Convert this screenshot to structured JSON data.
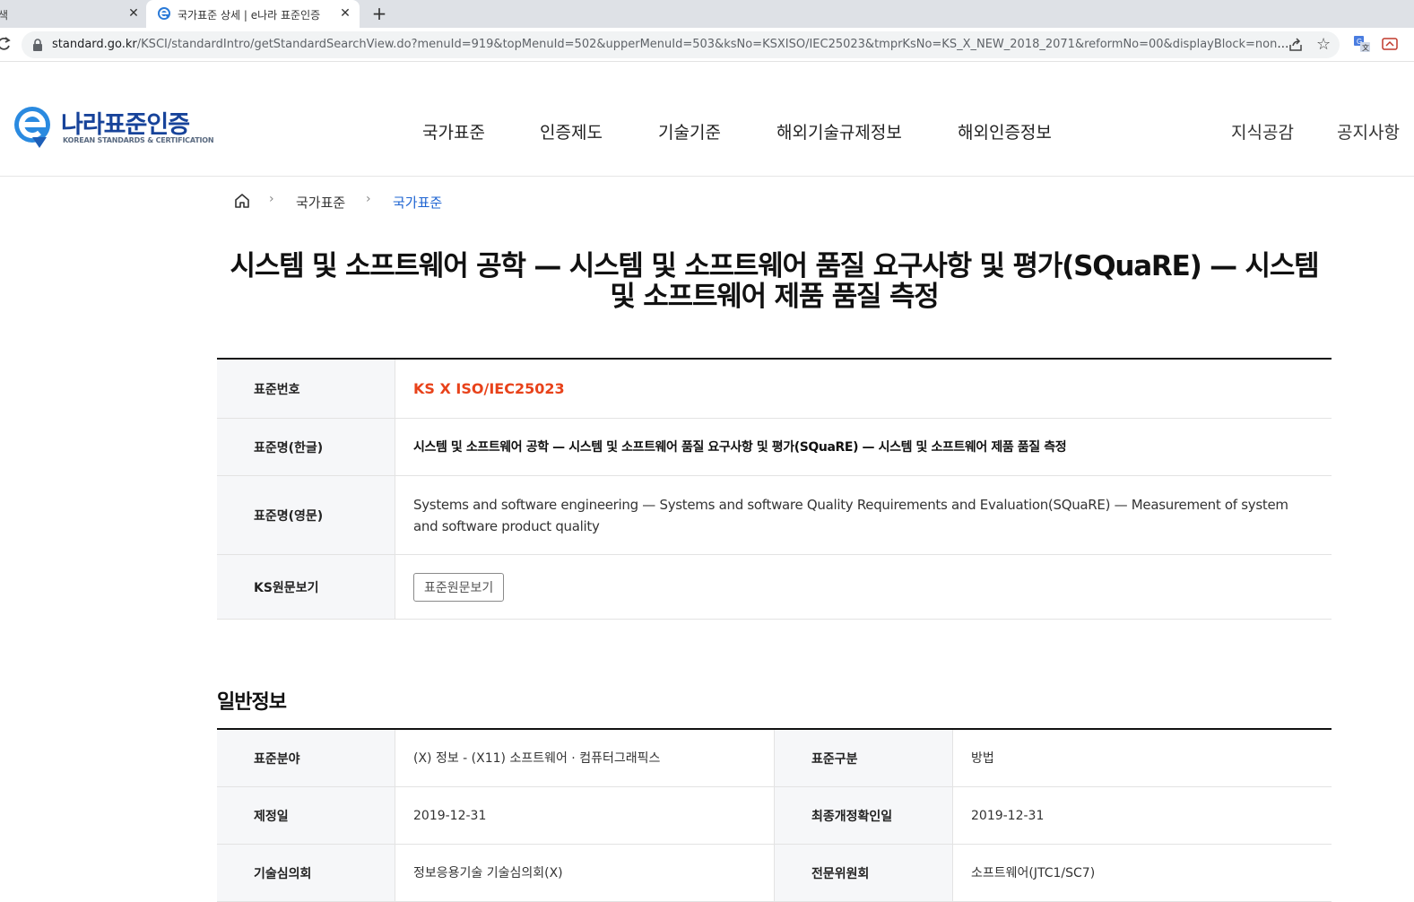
{
  "browser": {
    "prev_tab_title": "색",
    "active_tab_title": "국가표준 상세 | e나라 표준인증",
    "url_host": "standard.go.kr",
    "url_path": "/KSCI/standardIntro/getStandardSearchView.do?menuId=919&topMenuId=502&upperMenuId=503&ksNo=KSXISO/IEC25023&tmprKsNo=KS_X_NEW_2018_2071&reformNo=00&displayBlock=none&di..."
  },
  "site": {
    "logo_title": "나라표준인증",
    "logo_sub": "KOREAN STANDARDS & CERTIFICATION",
    "nav": [
      "국가표준",
      "인증제도",
      "기술기준",
      "해외기술규제정보",
      "해외인증정보"
    ],
    "util": [
      "지식공감",
      "공지사항"
    ]
  },
  "breadcrumb": {
    "items": [
      "국가표준",
      "국가표준"
    ]
  },
  "page_title": "시스템 및 소프트웨어 공학 — 시스템 및 소프트웨어 품질 요구사항 및 평가(SQuaRE) — 시스템 및 소프트웨어 제품 품질 측정",
  "standard": {
    "no_label": "표준번호",
    "no_value": "KS X ISO/IEC25023",
    "name_ko_label": "표준명(한글)",
    "name_ko_value": "시스템 및 소프트웨어 공학 — 시스템 및 소프트웨어 품질 요구사항 및 평가(SQuaRE) — 시스템 및 소프트웨어 제품 품질 측정",
    "name_en_label": "표준명(영문)",
    "name_en_value": "Systems and software engineering — Systems and software Quality Requirements and Evaluation(SQuaRE) — Measurement of system and software product quality",
    "view_label": "KS원문보기",
    "view_button": "표준원문보기"
  },
  "general": {
    "title": "일반정보",
    "rows": [
      {
        "l1": "표준분야",
        "v1": "(X) 정보 - (X11) 소프트웨어 · 컴퓨터그래픽스",
        "l2": "표준구분",
        "v2": "방법"
      },
      {
        "l1": "제정일",
        "v1": "2019-12-31",
        "l2": "최종개정확인일",
        "v2": "2019-12-31"
      },
      {
        "l1": "기술심의회",
        "v1": "정보응용기술 기술심의회(X)",
        "l2": "전문위원회",
        "v2": "소프트웨어(JTC1/SC7)"
      }
    ]
  },
  "colors": {
    "brand_blue": "#17439a",
    "standard_no_red": "#e8421a",
    "breadcrumb_active": "#1e64d2"
  }
}
